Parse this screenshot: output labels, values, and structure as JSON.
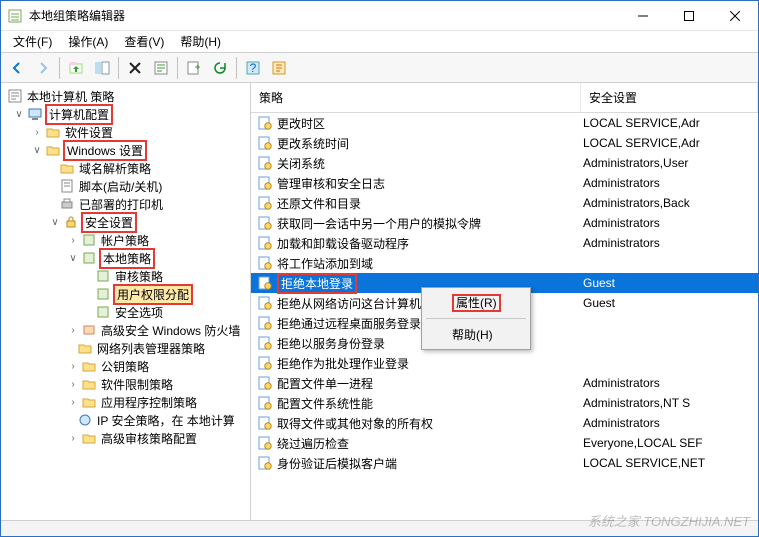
{
  "window": {
    "title": "本地组策略编辑器"
  },
  "menu": {
    "file": "文件(F)",
    "action": "操作(A)",
    "view": "查看(V)",
    "help": "帮助(H)"
  },
  "tree": {
    "root": "本地计算机 策略",
    "computer": "计算机配置",
    "software": "软件设置",
    "windows": "Windows 设置",
    "dns": "域名解析策略",
    "scripts": "脚本(启动/关机)",
    "printers": "已部署的打印机",
    "security": "安全设置",
    "account": "帐户策略",
    "local": "本地策略",
    "audit": "审核策略",
    "userrights": "用户权限分配",
    "secopts": "安全选项",
    "wfas": "高级安全 Windows 防火墙",
    "nlp": "网络列表管理器策略",
    "pubkey": "公钥策略",
    "srp": "软件限制策略",
    "appctrl": "应用程序控制策略",
    "ipsec": "IP 安全策略，在 本地计算",
    "advaudit": "高级审核策略配置"
  },
  "columns": {
    "policy": "策略",
    "setting": "安全设置"
  },
  "rows": [
    {
      "name": "更改时区",
      "setting": "LOCAL SERVICE,Adr"
    },
    {
      "name": "更改系统时间",
      "setting": "LOCAL SERVICE,Adr"
    },
    {
      "name": "关闭系统",
      "setting": "Administrators,User"
    },
    {
      "name": "管理审核和安全日志",
      "setting": "Administrators"
    },
    {
      "name": "还原文件和目录",
      "setting": "Administrators,Back"
    },
    {
      "name": "获取同一会话中另一个用户的模拟令牌",
      "setting": "Administrators"
    },
    {
      "name": "加载和卸载设备驱动程序",
      "setting": "Administrators"
    },
    {
      "name": "将工作站添加到域",
      "setting": ""
    },
    {
      "name": "拒绝本地登录",
      "setting": "Guest",
      "selected": true,
      "boxed": true
    },
    {
      "name": "拒绝从网络访问这台计算机",
      "setting": "Guest"
    },
    {
      "name": "拒绝通过远程桌面服务登录",
      "setting": ""
    },
    {
      "name": "拒绝以服务身份登录",
      "setting": ""
    },
    {
      "name": "拒绝作为批处理作业登录",
      "setting": ""
    },
    {
      "name": "配置文件单一进程",
      "setting": "Administrators"
    },
    {
      "name": "配置文件系统性能",
      "setting": "Administrators,NT S"
    },
    {
      "name": "取得文件或其他对象的所有权",
      "setting": "Administrators"
    },
    {
      "name": "绕过遍历检查",
      "setting": "Everyone,LOCAL SEF"
    },
    {
      "name": "身份验证后模拟客户端",
      "setting": "LOCAL SERVICE,NET"
    }
  ],
  "context": {
    "properties": "属性(R)",
    "help": "帮助(H)"
  },
  "watermark": "系统之家 TONGZHIJIA.NET"
}
